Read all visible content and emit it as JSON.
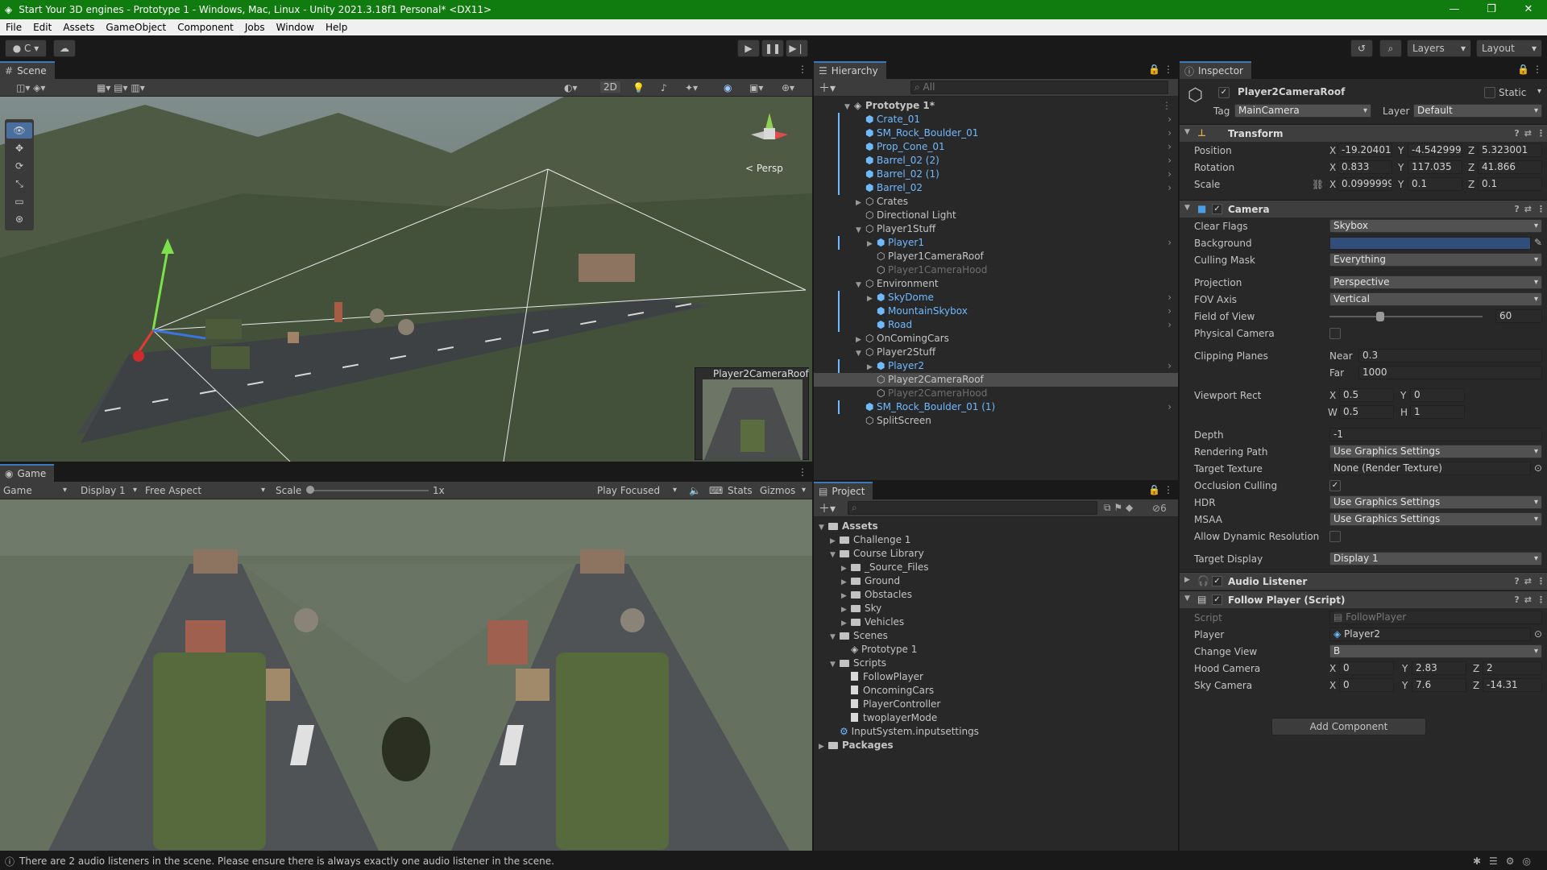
{
  "window": {
    "title": "Start Your 3D engines - Prototype 1 - Windows, Mac, Linux - Unity 2021.3.18f1 Personal* <DX11>",
    "minimize": "—",
    "maximize": "❐",
    "close": "✕"
  },
  "menu": [
    "File",
    "Edit",
    "Assets",
    "GameObject",
    "Component",
    "Jobs",
    "Window",
    "Help"
  ],
  "toolbar": {
    "account": "C",
    "layers": "Layers",
    "layout": "Layout"
  },
  "scene": {
    "tab": "Scene",
    "toggle_2d": "2D",
    "persp": "< Persp",
    "camera_preview": "Player2CameraRoof"
  },
  "game": {
    "tab": "Game",
    "view": "Game",
    "display": "Display 1",
    "aspect": "Free Aspect",
    "scale_label": "Scale",
    "scale_value": "1x",
    "play_mode": "Play Focused",
    "stats": "Stats",
    "gizmos": "Gizmos"
  },
  "hierarchy": {
    "tab": "Hierarchy",
    "search": "All",
    "rows": [
      {
        "label": "Prototype 1*",
        "indent": 0,
        "tri": "▼",
        "kind": "scene",
        "style": "bold"
      },
      {
        "label": "Crate_01",
        "indent": 1,
        "tri": "",
        "kind": "prefab",
        "style": "blue"
      },
      {
        "label": "SM_Rock_Boulder_01",
        "indent": 1,
        "tri": "",
        "kind": "prefab",
        "style": "blue"
      },
      {
        "label": "Prop_Cone_01",
        "indent": 1,
        "tri": "",
        "kind": "prefab",
        "style": "blue"
      },
      {
        "label": "Barrel_02 (2)",
        "indent": 1,
        "tri": "",
        "kind": "prefab",
        "style": "blue"
      },
      {
        "label": "Barrel_02 (1)",
        "indent": 1,
        "tri": "",
        "kind": "prefab",
        "style": "blue"
      },
      {
        "label": "Barrel_02",
        "indent": 1,
        "tri": "",
        "kind": "prefab",
        "style": "blue"
      },
      {
        "label": "Crates",
        "indent": 1,
        "tri": "▶",
        "kind": "object",
        "style": "normal"
      },
      {
        "label": "Directional Light",
        "indent": 1,
        "tri": "",
        "kind": "object",
        "style": "normal"
      },
      {
        "label": "Player1Stuff",
        "indent": 1,
        "tri": "▼",
        "kind": "object",
        "style": "normal"
      },
      {
        "label": "Player1",
        "indent": 2,
        "tri": "▶",
        "kind": "prefab",
        "style": "blue"
      },
      {
        "label": "Player1CameraRoof",
        "indent": 2,
        "tri": "",
        "kind": "object",
        "style": "normal"
      },
      {
        "label": "Player1CameraHood",
        "indent": 2,
        "tri": "",
        "kind": "object",
        "style": "dim"
      },
      {
        "label": "Environment",
        "indent": 1,
        "tri": "▼",
        "kind": "object",
        "style": "normal"
      },
      {
        "label": "SkyDome",
        "indent": 2,
        "tri": "▶",
        "kind": "prefab",
        "style": "blue"
      },
      {
        "label": "MountainSkybox",
        "indent": 2,
        "tri": "",
        "kind": "prefab",
        "style": "blue"
      },
      {
        "label": "Road",
        "indent": 2,
        "tri": "",
        "kind": "prefab",
        "style": "blue"
      },
      {
        "label": "OnComingCars",
        "indent": 1,
        "tri": "▶",
        "kind": "object",
        "style": "normal"
      },
      {
        "label": "Player2Stuff",
        "indent": 1,
        "tri": "▼",
        "kind": "object",
        "style": "normal"
      },
      {
        "label": "Player2",
        "indent": 2,
        "tri": "▶",
        "kind": "prefab",
        "style": "blue"
      },
      {
        "label": "Player2CameraRoof",
        "indent": 2,
        "tri": "",
        "kind": "object",
        "style": "selected"
      },
      {
        "label": "Player2CameraHood",
        "indent": 2,
        "tri": "",
        "kind": "object",
        "style": "dim"
      },
      {
        "label": "SM_Rock_Boulder_01 (1)",
        "indent": 1,
        "tri": "",
        "kind": "prefab",
        "style": "blue"
      },
      {
        "label": "SplitScreen",
        "indent": 1,
        "tri": "",
        "kind": "object",
        "style": "normal"
      }
    ]
  },
  "project": {
    "tab": "Project",
    "hidden_count": "6",
    "rows": [
      {
        "label": "Assets",
        "indent": 0,
        "tri": "▼",
        "kind": "folder",
        "style": "bold"
      },
      {
        "label": "Challenge 1",
        "indent": 1,
        "tri": "▶",
        "kind": "folder",
        "style": "normal"
      },
      {
        "label": "Course Library",
        "indent": 1,
        "tri": "▼",
        "kind": "folder",
        "style": "normal"
      },
      {
        "label": "_Source_Files",
        "indent": 2,
        "tri": "▶",
        "kind": "folder",
        "style": "normal"
      },
      {
        "label": "Ground",
        "indent": 2,
        "tri": "▶",
        "kind": "folder",
        "style": "normal"
      },
      {
        "label": "Obstacles",
        "indent": 2,
        "tri": "▶",
        "kind": "folder",
        "style": "normal"
      },
      {
        "label": "Sky",
        "indent": 2,
        "tri": "▶",
        "kind": "folder",
        "style": "normal"
      },
      {
        "label": "Vehicles",
        "indent": 2,
        "tri": "▶",
        "kind": "folder",
        "style": "normal"
      },
      {
        "label": "Scenes",
        "indent": 1,
        "tri": "▼",
        "kind": "folder",
        "style": "normal"
      },
      {
        "label": "Prototype 1",
        "indent": 2,
        "tri": "",
        "kind": "scene",
        "style": "normal"
      },
      {
        "label": "Scripts",
        "indent": 1,
        "tri": "▼",
        "kind": "folder",
        "style": "normal"
      },
      {
        "label": "FollowPlayer",
        "indent": 2,
        "tri": "",
        "kind": "file",
        "style": "normal"
      },
      {
        "label": "OncomingCars",
        "indent": 2,
        "tri": "",
        "kind": "file",
        "style": "normal"
      },
      {
        "label": "PlayerController",
        "indent": 2,
        "tri": "",
        "kind": "file",
        "style": "normal"
      },
      {
        "label": "twoplayerMode",
        "indent": 2,
        "tri": "",
        "kind": "file",
        "style": "normal"
      },
      {
        "label": "InputSystem.inputsettings",
        "indent": 1,
        "tri": "",
        "kind": "settings",
        "style": "normal"
      },
      {
        "label": "Packages",
        "indent": 0,
        "tri": "▶",
        "kind": "folder",
        "style": "bold"
      }
    ]
  },
  "inspector": {
    "tab": "Inspector",
    "object_name": "Player2CameraRoof",
    "static_label": "Static",
    "tag_label": "Tag",
    "tag": "MainCamera",
    "layer_label": "Layer",
    "layer": "Default",
    "transform": {
      "title": "Transform",
      "position_label": "Position",
      "rotation_label": "Rotation",
      "scale_label": "Scale",
      "position": {
        "x": "-19.20401",
        "y": "-4.542999",
        "z": "5.323001"
      },
      "rotation": {
        "x": "0.833",
        "y": "117.035",
        "z": "41.866"
      },
      "scale": {
        "x": "0.09999999",
        "y": "0.1",
        "z": "0.1"
      }
    },
    "camera": {
      "title": "Camera",
      "clear_flags_label": "Clear Flags",
      "clear_flags": "Skybox",
      "background_label": "Background",
      "background_color": "#314d79",
      "culling_mask_label": "Culling Mask",
      "culling_mask": "Everything",
      "projection_label": "Projection",
      "projection": "Perspective",
      "fov_axis_label": "FOV Axis",
      "fov_axis": "Vertical",
      "fov_label": "Field of View",
      "fov": "60",
      "fov_fraction": 0.33,
      "physical_camera_label": "Physical Camera",
      "clipping_label": "Clipping Planes",
      "near_label": "Near",
      "near": "0.3",
      "far_label": "Far",
      "far": "1000",
      "viewport_label": "Viewport Rect",
      "vp_x": "0.5",
      "vp_y": "0",
      "vp_w": "0.5",
      "vp_h": "1",
      "depth_label": "Depth",
      "depth": "-1",
      "rendering_path_label": "Rendering Path",
      "rendering_path": "Use Graphics Settings",
      "target_texture_label": "Target Texture",
      "target_texture": "None (Render Texture)",
      "occlusion_label": "Occlusion Culling",
      "hdr_label": "HDR",
      "hdr": "Use Graphics Settings",
      "msaa_label": "MSAA",
      "msaa": "Use Graphics Settings",
      "dynres_label": "Allow Dynamic Resolution",
      "target_display_label": "Target Display",
      "target_display": "Display 1"
    },
    "audio_listener": {
      "title": "Audio Listener"
    },
    "follow_player": {
      "title": "Follow Player (Script)",
      "script_label": "Script",
      "script": "FollowPlayer",
      "player_label": "Player",
      "player": "Player2",
      "change_view_label": "Change View",
      "change_view": "B",
      "hood_label": "Hood Camera",
      "hood": {
        "x": "0",
        "y": "2.83",
        "z": "2"
      },
      "sky_label": "Sky Camera",
      "sky": {
        "x": "0",
        "y": "7.6",
        "z": "-14.31"
      }
    },
    "add_component": "Add Component"
  },
  "status": {
    "message": "There are 2 audio listeners in the scene. Please ensure there is always exactly one audio listener in the scene."
  },
  "colors": {
    "accent": "#3a79bb",
    "title_bar": "#107c10",
    "prefab_blue": "#6fb9ff"
  }
}
